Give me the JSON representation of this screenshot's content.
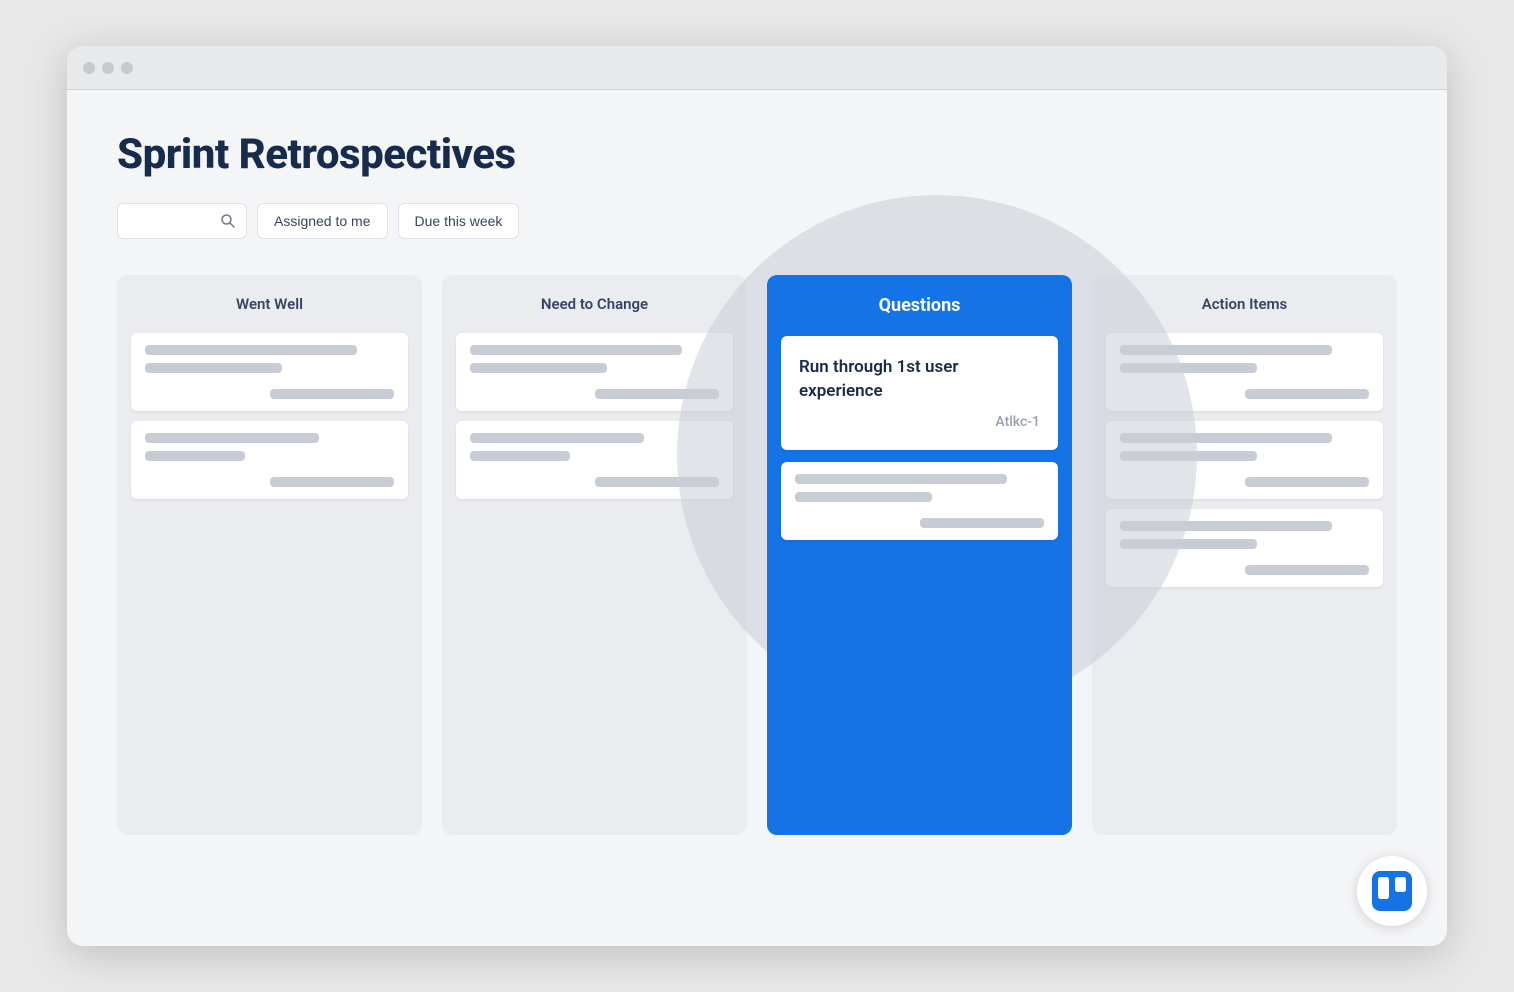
{
  "page": {
    "title": "Sprint Retrospectives"
  },
  "toolbar": {
    "search_placeholder": "Search",
    "filter1_label": "Assigned to me",
    "filter2_label": "Due this week"
  },
  "columns": [
    {
      "id": "went-well",
      "header": "Went Well",
      "cards": [
        {
          "lines": [
            "long",
            "short"
          ],
          "has_bottom": true
        },
        {
          "lines": [
            "medium",
            "xshort"
          ],
          "has_bottom": true
        }
      ]
    },
    {
      "id": "need-to-change",
      "header": "Need to Change",
      "cards": [
        {
          "lines": [
            "long",
            "short"
          ],
          "has_bottom": true
        },
        {
          "lines": [
            "medium",
            "xshort"
          ],
          "has_bottom": true
        }
      ]
    },
    {
      "id": "questions",
      "header": "Questions",
      "highlighted": true,
      "featured_card": {
        "title": "Run through 1st user experience",
        "id": "Atlkc-1"
      },
      "cards": [
        {
          "lines": [
            "long",
            "short"
          ],
          "has_bottom": true
        }
      ]
    },
    {
      "id": "action-items",
      "header": "Action Items",
      "cards": [
        {
          "lines": [
            "long",
            "short"
          ],
          "has_bottom": true
        },
        {
          "lines": [
            "long",
            "short"
          ],
          "has_bottom": true
        },
        {
          "lines": [
            "long",
            "short"
          ],
          "has_bottom": true
        }
      ]
    }
  ],
  "icons": {
    "search": "&#128269;"
  }
}
